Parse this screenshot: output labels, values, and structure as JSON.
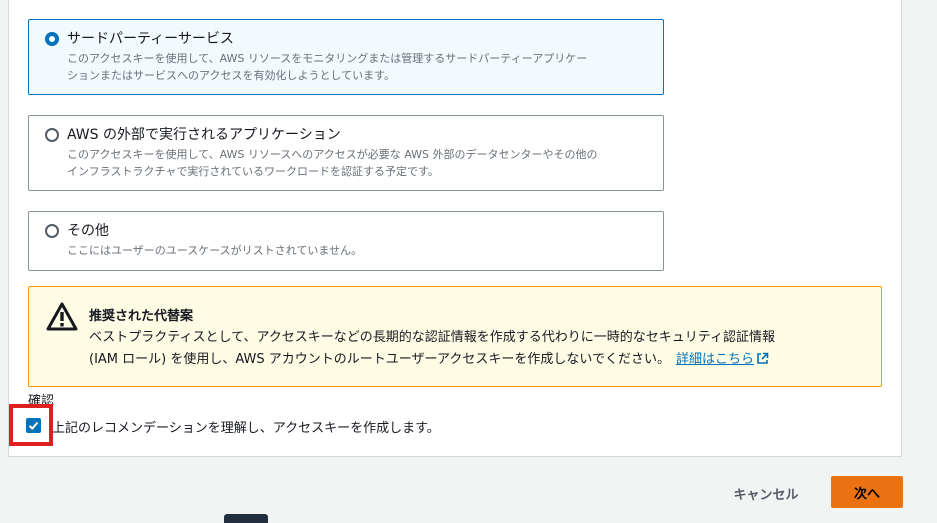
{
  "options": [
    {
      "title": "サードパーティーサービス",
      "desc1": "このアクセスキーを使用して、AWS リソースをモニタリングまたは管理するサードパーティーアプリケー",
      "desc2": "ションまたはサービスへのアクセスを有効化しようとしています。",
      "selected": true
    },
    {
      "title": "AWS の外部で実行されるアプリケーション",
      "desc1": "このアクセスキーを使用して、AWS リソースへのアクセスが必要な AWS 外部のデータセンターやその他の",
      "desc2": "インフラストラクチャで実行されているワークロードを認証する予定です。",
      "selected": false
    },
    {
      "title": "その他",
      "desc1": "ここにはユーザーのユースケースがリストされていません。",
      "selected": false
    }
  ],
  "alert": {
    "title": "推奨された代替案",
    "line1": "ベストプラクティスとして、アクセスキーなどの長期的な認証情報を作成する代わりに一時的なセキュリティ認証情報",
    "line2": "(IAM ロール) を使用し、AWS アカウントのルートユーザーアクセスキーを作成しないでください。",
    "link": "詳細はこちら"
  },
  "confirmation": {
    "label": "確認",
    "checkbox_text": "上記のレコメンデーションを理解し、アクセスキーを作成します。",
    "checked": true
  },
  "buttons": {
    "cancel": "キャンセル",
    "next": "次へ"
  },
  "icons": {
    "radio": "radio-icon",
    "warning": "warning-icon",
    "external_link": "external-link-icon",
    "checkbox": "checkmark-icon"
  },
  "colors": {
    "accent": "#0073bb",
    "primary_button": "#ec7211",
    "warning_border": "#ff9900",
    "warning_bg": "#fffce6",
    "highlight": "#e02020"
  }
}
